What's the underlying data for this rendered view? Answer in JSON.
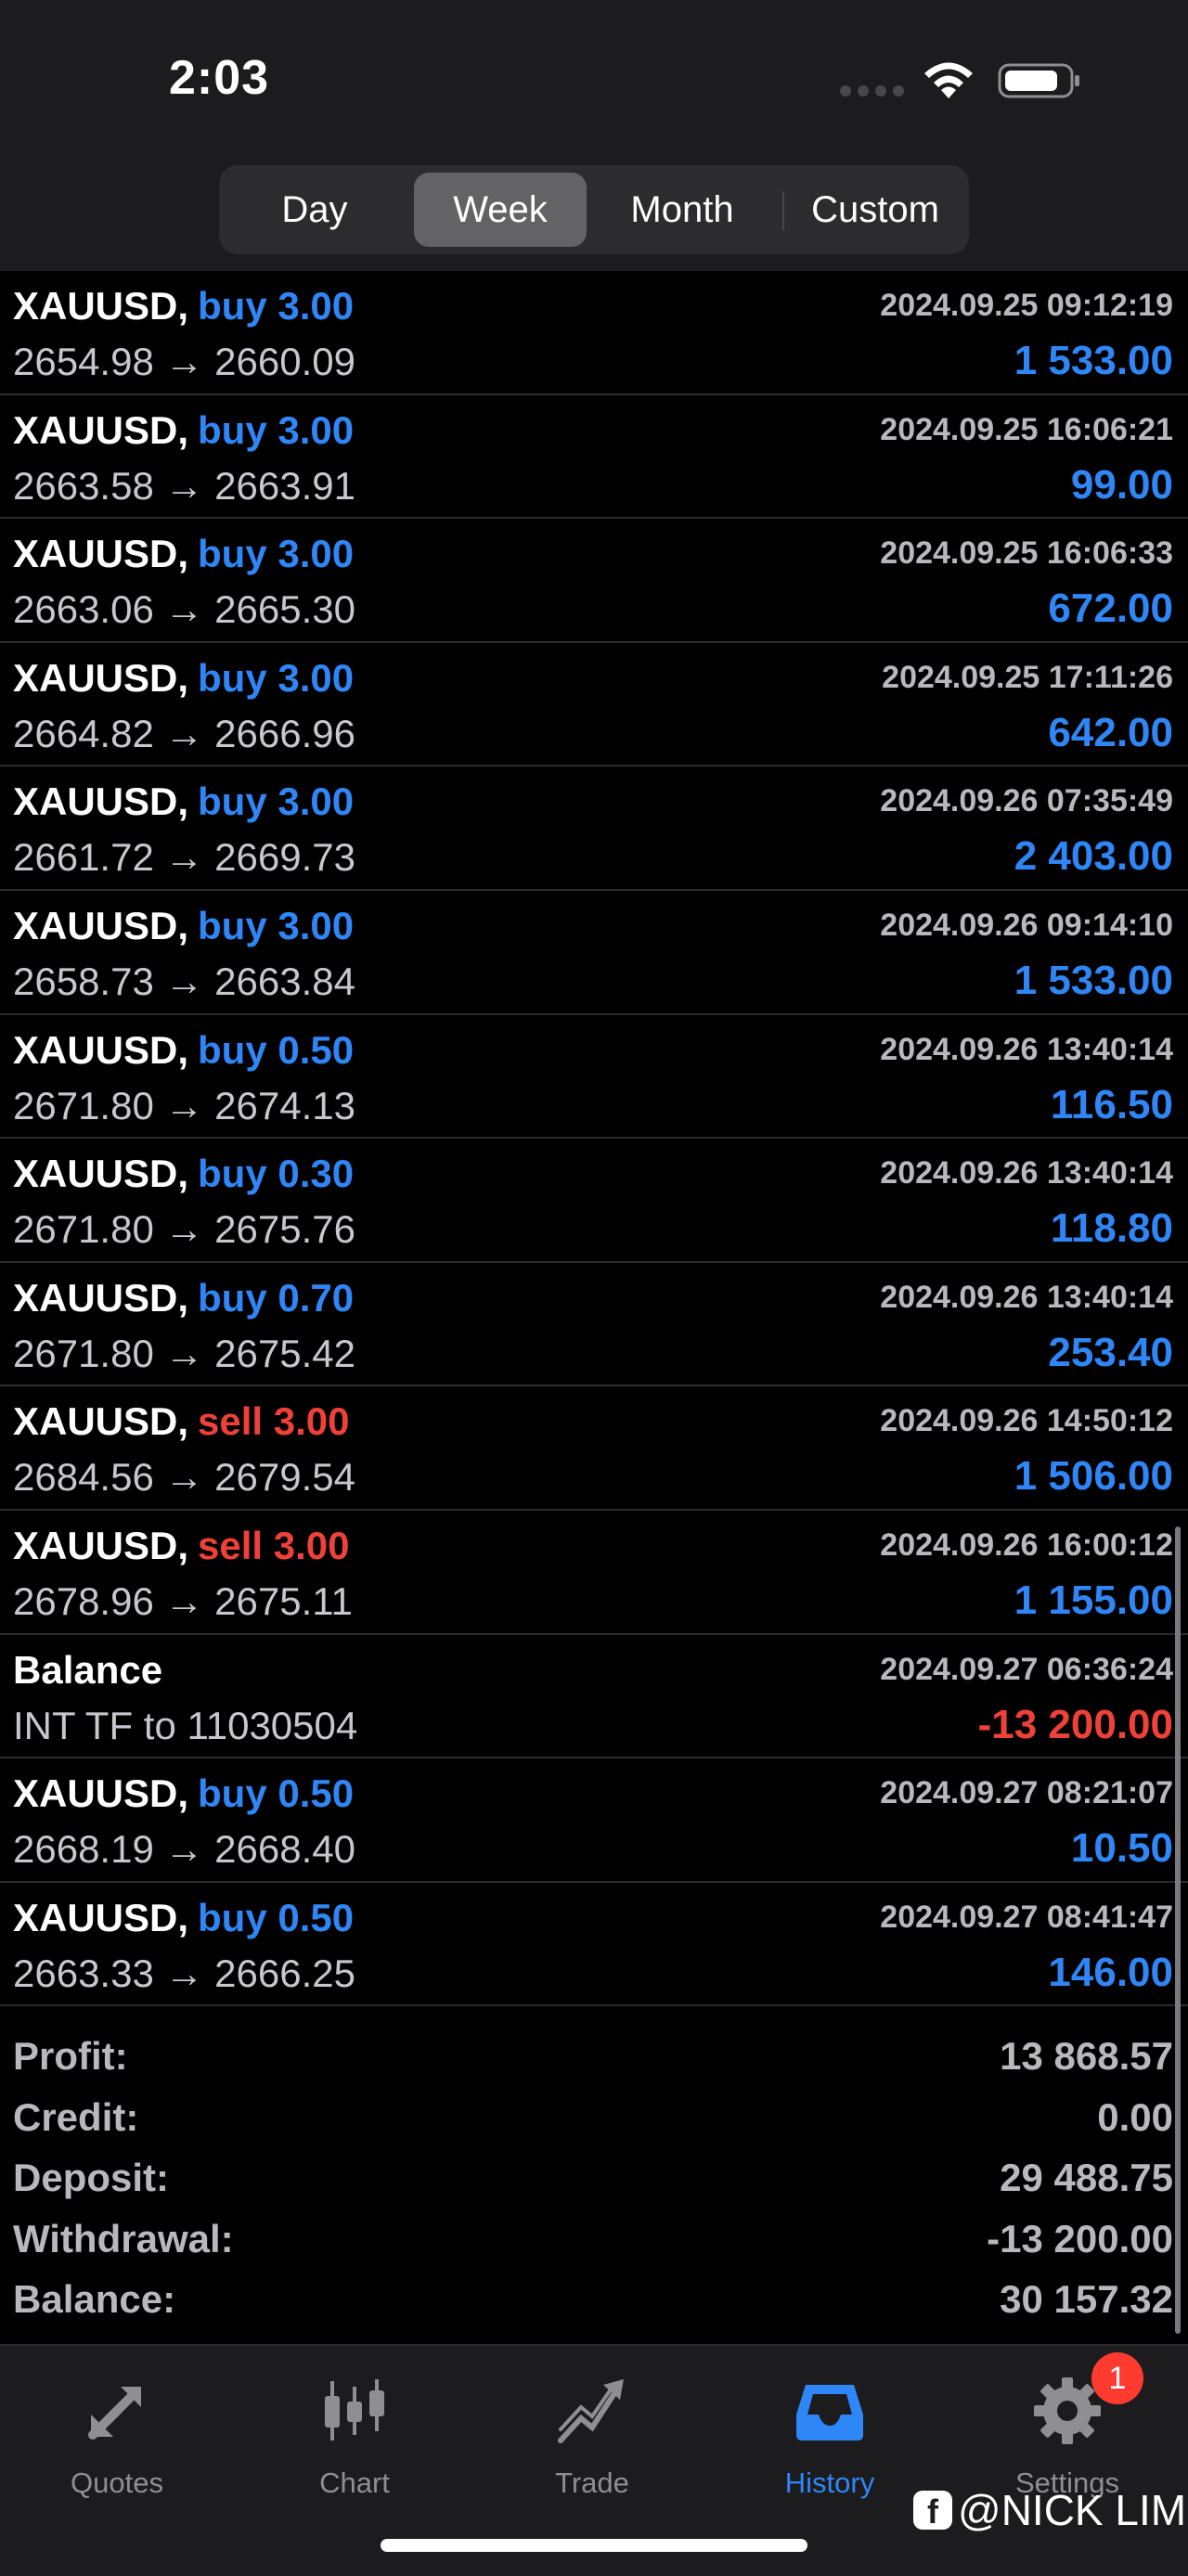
{
  "status": {
    "time": "2:03"
  },
  "tabs": [
    {
      "label": "Day",
      "active": false
    },
    {
      "label": "Week",
      "active": true
    },
    {
      "label": "Month",
      "active": false
    },
    {
      "label": "Custom",
      "active": false
    }
  ],
  "trades": [
    {
      "symbol": "XAUUSD,",
      "action": "buy 3.00",
      "type": "buy",
      "prices": "2654.98 → 2660.09",
      "time": "2024.09.25 09:12:19",
      "profit": "1 533.00",
      "profit_color": "blue"
    },
    {
      "symbol": "XAUUSD,",
      "action": "buy 3.00",
      "type": "buy",
      "prices": "2663.58 → 2663.91",
      "time": "2024.09.25 16:06:21",
      "profit": "99.00",
      "profit_color": "blue"
    },
    {
      "symbol": "XAUUSD,",
      "action": "buy 3.00",
      "type": "buy",
      "prices": "2663.06 → 2665.30",
      "time": "2024.09.25 16:06:33",
      "profit": "672.00",
      "profit_color": "blue"
    },
    {
      "symbol": "XAUUSD,",
      "action": "buy 3.00",
      "type": "buy",
      "prices": "2664.82 → 2666.96",
      "time": "2024.09.25 17:11:26",
      "profit": "642.00",
      "profit_color": "blue"
    },
    {
      "symbol": "XAUUSD,",
      "action": "buy 3.00",
      "type": "buy",
      "prices": "2661.72 → 2669.73",
      "time": "2024.09.26 07:35:49",
      "profit": "2 403.00",
      "profit_color": "blue"
    },
    {
      "symbol": "XAUUSD,",
      "action": "buy 3.00",
      "type": "buy",
      "prices": "2658.73 → 2663.84",
      "time": "2024.09.26 09:14:10",
      "profit": "1 533.00",
      "profit_color": "blue"
    },
    {
      "symbol": "XAUUSD,",
      "action": "buy 0.50",
      "type": "buy",
      "prices": "2671.80 → 2674.13",
      "time": "2024.09.26 13:40:14",
      "profit": "116.50",
      "profit_color": "blue"
    },
    {
      "symbol": "XAUUSD,",
      "action": "buy 0.30",
      "type": "buy",
      "prices": "2671.80 → 2675.76",
      "time": "2024.09.26 13:40:14",
      "profit": "118.80",
      "profit_color": "blue"
    },
    {
      "symbol": "XAUUSD,",
      "action": "buy 0.70",
      "type": "buy",
      "prices": "2671.80 → 2675.42",
      "time": "2024.09.26 13:40:14",
      "profit": "253.40",
      "profit_color": "blue"
    },
    {
      "symbol": "XAUUSD,",
      "action": "sell 3.00",
      "type": "sell",
      "prices": "2684.56 → 2679.54",
      "time": "2024.09.26 14:50:12",
      "profit": "1 506.00",
      "profit_color": "blue"
    },
    {
      "symbol": "XAUUSD,",
      "action": "sell 3.00",
      "type": "sell",
      "prices": "2678.96 → 2675.11",
      "time": "2024.09.26 16:00:12",
      "profit": "1 155.00",
      "profit_color": "blue"
    },
    {
      "symbol": "Balance",
      "action": "",
      "type": "balance",
      "prices": "INT TF to 11030504",
      "time": "2024.09.27 06:36:24",
      "profit": "-13 200.00",
      "profit_color": "red"
    },
    {
      "symbol": "XAUUSD,",
      "action": "buy 0.50",
      "type": "buy",
      "prices": "2668.19 → 2668.40",
      "time": "2024.09.27 08:21:07",
      "profit": "10.50",
      "profit_color": "blue"
    },
    {
      "symbol": "XAUUSD,",
      "action": "buy 0.50",
      "type": "buy",
      "prices": "2663.33 → 2666.25",
      "time": "2024.09.27 08:41:47",
      "profit": "146.00",
      "profit_color": "blue"
    }
  ],
  "summary": [
    {
      "label": "Profit:",
      "value": "13 868.57"
    },
    {
      "label": "Credit:",
      "value": "0.00"
    },
    {
      "label": "Deposit:",
      "value": "29 488.75"
    },
    {
      "label": "Withdrawal:",
      "value": "-13 200.00"
    },
    {
      "label": "Balance:",
      "value": "30 157.32"
    }
  ],
  "tabbar": [
    {
      "label": "Quotes",
      "icon": "quotes-icon",
      "active": false
    },
    {
      "label": "Chart",
      "icon": "chart-icon",
      "active": false
    },
    {
      "label": "Trade",
      "icon": "trade-icon",
      "active": false
    },
    {
      "label": "History",
      "icon": "history-icon",
      "active": true
    },
    {
      "label": "Settings",
      "icon": "gear-icon",
      "active": false
    }
  ],
  "settings_badge": "1",
  "watermark": "@NICK LIM",
  "colors": {
    "blue": "#2f86f6",
    "red": "#ef4138",
    "active_tab": "#2f86f6"
  }
}
